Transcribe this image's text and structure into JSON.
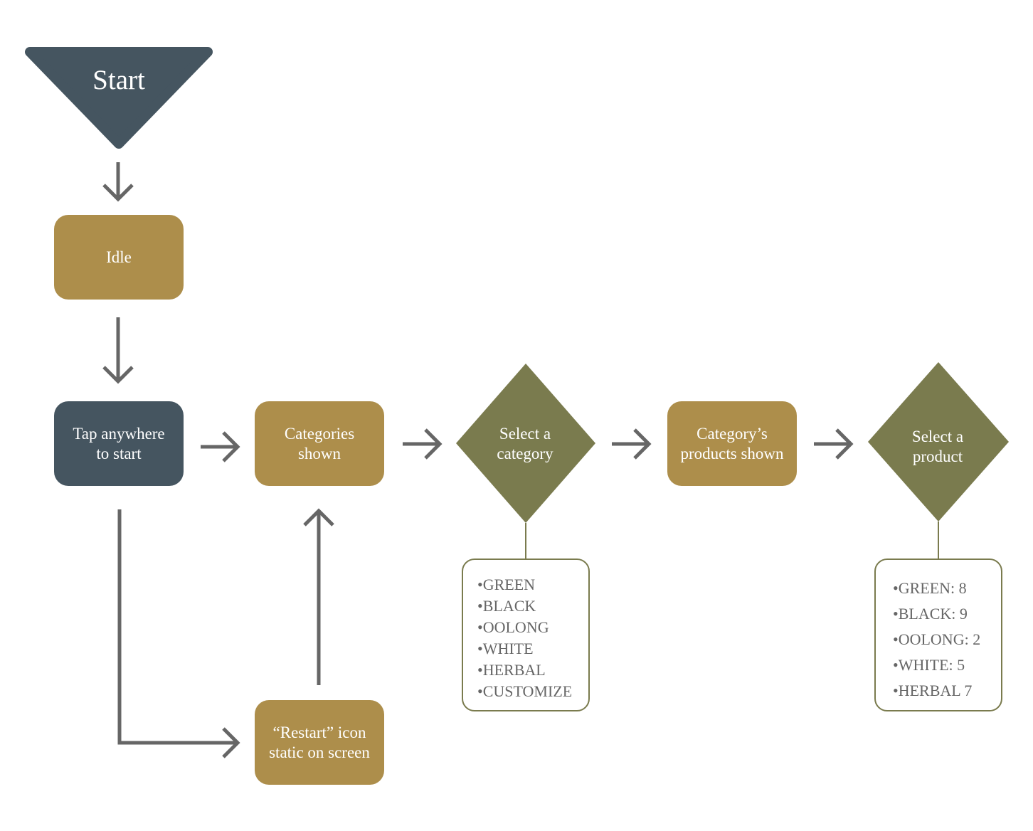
{
  "colors": {
    "slate": "#455560",
    "gold": "#ad8e4b",
    "olive": "#7a7b4e",
    "arrow": "#666666"
  },
  "nodes": {
    "start": "Start",
    "idle": "Idle",
    "tap": [
      "Tap anywhere",
      "to start"
    ],
    "categories": [
      "Categories",
      "shown"
    ],
    "select_category": [
      "Select a",
      "category"
    ],
    "products": [
      "Category’s",
      "products shown"
    ],
    "select_product": [
      "Select a",
      "product"
    ],
    "restart": [
      "“Restart” icon",
      "static on screen"
    ]
  },
  "category_list": [
    "•GREEN",
    "•BLACK",
    "•OOLONG",
    "•WHITE",
    "•HERBAL",
    "•CUSTOMIZE"
  ],
  "product_list": [
    "•GREEN: 8",
    "•BLACK: 9",
    "•OOLONG: 2",
    "•WHITE: 5",
    "•HERBAL 7"
  ]
}
